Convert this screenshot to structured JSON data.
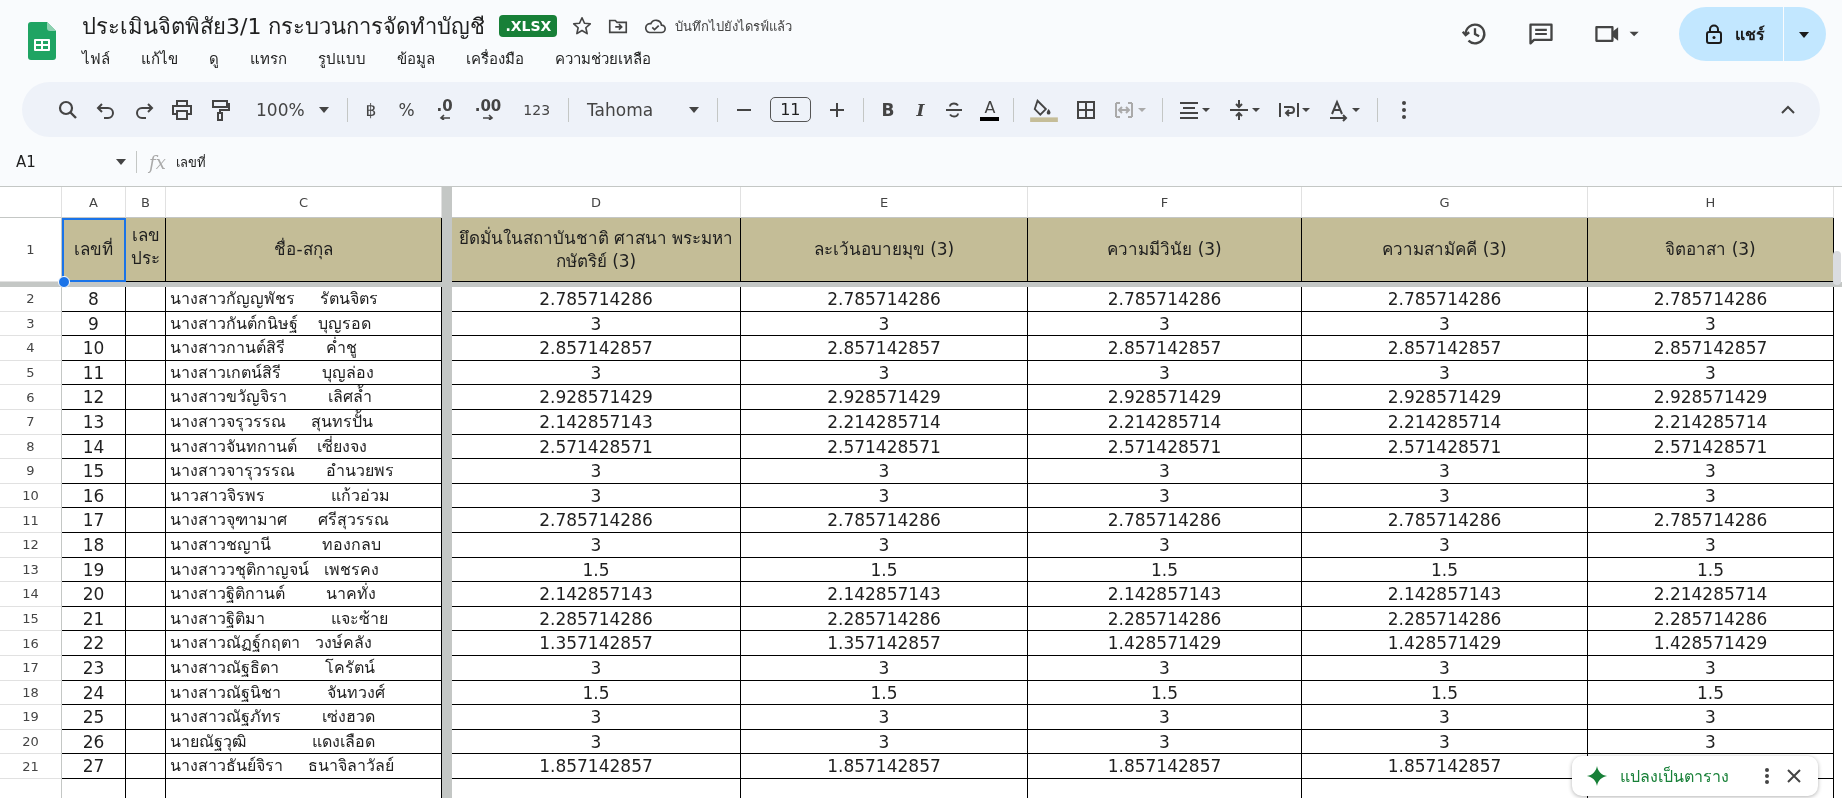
{
  "document": {
    "title": "ประเมินจิตพิสัย3/1 กระบวนการจัดทำบัญชี",
    "format_badge": ".XLSX",
    "save_status": "บันทึกไปยังไดรฟ์แล้ว"
  },
  "menu": [
    "ไฟล์",
    "แก้ไข",
    "ดู",
    "แทรก",
    "รูปแบบ",
    "ข้อมูล",
    "เครื่องมือ",
    "ความช่วยเหลือ"
  ],
  "share_button": "แชร์",
  "toolbar": {
    "zoom": "100%",
    "currency": "฿",
    "percent": "%",
    "decrease_decimals": ".0",
    "increase_decimals": ".00",
    "number_format": "123",
    "font": "Tahoma",
    "font_size": "11",
    "bold": "B",
    "italic": "I",
    "text_color": "A"
  },
  "formula_bar": {
    "name_box": "A1",
    "fx": "fx",
    "value": "เลขที่"
  },
  "sheet": {
    "columns": [
      "A",
      "B",
      "C",
      "D",
      "E",
      "F",
      "G",
      "H"
    ],
    "header_row": {
      "number": "1",
      "cells": [
        {
          "text": "เลขที่",
          "selected": true
        },
        {
          "text": "เลขประ",
          "selected": false
        },
        {
          "text": "ชื่อ-สกุล",
          "selected": false
        },
        {
          "text": "ยึดมั่นในสถาบันชาติ ศาสนา พระมหากษัตริย์ (3)",
          "selected": false
        },
        {
          "text": "ละเว้นอบายมุข (3)",
          "selected": false
        },
        {
          "text": "ความมีวินัย (3)",
          "selected": false
        },
        {
          "text": "ความสามัคคี (3)",
          "selected": false
        },
        {
          "text": "จิตอาสา (3)",
          "selected": false
        }
      ]
    },
    "rows": [
      {
        "number": "2",
        "no": "8",
        "name": "นางสาวกัญญพัชร     รัตนจิตร",
        "scores": [
          "2.785714286",
          "2.785714286",
          "2.785714286",
          "2.785714286",
          "2.785714286"
        ]
      },
      {
        "number": "3",
        "no": "9",
        "name": "นางสาวกันต์กนิษฐ์    บุญรอด",
        "scores": [
          "3",
          "3",
          "3",
          "3",
          "3"
        ]
      },
      {
        "number": "4",
        "no": "10",
        "name": "นางสาวกานต์สิรี        ค่ำชู",
        "scores": [
          "2.857142857",
          "2.857142857",
          "2.857142857",
          "2.857142857",
          "2.857142857"
        ]
      },
      {
        "number": "5",
        "no": "11",
        "name": "นางสาวเกตน์สิรี        บุญล่อง",
        "scores": [
          "3",
          "3",
          "3",
          "3",
          "3"
        ]
      },
      {
        "number": "6",
        "no": "12",
        "name": "นางสาวขวัญจิรา        เลิศล้ำ",
        "scores": [
          "2.928571429",
          "2.928571429",
          "2.928571429",
          "2.928571429",
          "2.928571429"
        ]
      },
      {
        "number": "7",
        "no": "13",
        "name": "นางสาวจรุวรรณ     สุนทรปั้น",
        "scores": [
          "2.142857143",
          "2.214285714",
          "2.214285714",
          "2.214285714",
          "2.214285714"
        ]
      },
      {
        "number": "8",
        "no": "14",
        "name": "นางสาวจันทกานต์    เซี่ยงจง",
        "scores": [
          "2.571428571",
          "2.571428571",
          "2.571428571",
          "2.571428571",
          "2.571428571"
        ]
      },
      {
        "number": "9",
        "no": "15",
        "name": "นางสาวจารุวรรณ      อำนวยพร",
        "scores": [
          "3",
          "3",
          "3",
          "3",
          "3"
        ]
      },
      {
        "number": "10",
        "no": "16",
        "name": "นาวสาวจิรพร             แก้วอ่วม",
        "scores": [
          "3",
          "3",
          "3",
          "3",
          "3"
        ]
      },
      {
        "number": "11",
        "no": "17",
        "name": "นางสาวจุฑามาศ      ศรีสุวรรณ",
        "scores": [
          "2.785714286",
          "2.785714286",
          "2.785714286",
          "2.785714286",
          "2.785714286"
        ]
      },
      {
        "number": "12",
        "no": "18",
        "name": "นางสาวชญานี          ทองกลบ",
        "scores": [
          "3",
          "3",
          "3",
          "3",
          "3"
        ]
      },
      {
        "number": "13",
        "no": "19",
        "name": "นางสาววชุติกาญจน์   เพชรคง",
        "scores": [
          "1.5",
          "1.5",
          "1.5",
          "1.5",
          "1.5"
        ]
      },
      {
        "number": "14",
        "no": "20",
        "name": "นางสาวฐิติกานต์        นาคทั่ง",
        "scores": [
          "2.142857143",
          "2.142857143",
          "2.142857143",
          "2.142857143",
          "2.214285714"
        ]
      },
      {
        "number": "15",
        "no": "21",
        "name": "นางสาวฐิติมา             แจะซ้าย",
        "scores": [
          "2.285714286",
          "2.285714286",
          "2.285714286",
          "2.285714286",
          "2.285714286"
        ]
      },
      {
        "number": "16",
        "no": "22",
        "name": "นางสาวณัฏฐ์กฤตา   วงษ์คลัง",
        "scores": [
          "1.357142857",
          "1.357142857",
          "1.428571429",
          "1.428571429",
          "1.428571429"
        ]
      },
      {
        "number": "17",
        "no": "23",
        "name": "นางสาวณัฐธิดา         โครัตน์",
        "scores": [
          "3",
          "3",
          "3",
          "3",
          "3"
        ]
      },
      {
        "number": "18",
        "no": "24",
        "name": "นางสาวณัฐนิชา         จันทวงศ์",
        "scores": [
          "1.5",
          "1.5",
          "1.5",
          "1.5",
          "1.5"
        ]
      },
      {
        "number": "19",
        "no": "25",
        "name": "นางสาวณัฐภัทร        เซ่งฮวด",
        "scores": [
          "3",
          "3",
          "3",
          "3",
          "3"
        ]
      },
      {
        "number": "20",
        "no": "26",
        "name": "นายณัฐวุฒิ             แดงเลือด",
        "scores": [
          "3",
          "3",
          "3",
          "3",
          "3"
        ]
      },
      {
        "number": "21",
        "no": "27",
        "name": "นางสาวธันย์จิรา     ธนาจิลาวัลย์",
        "scores": [
          "1.857142857",
          "1.857142857",
          "1.857142857",
          "1.857142857"
        ]
      }
    ]
  },
  "toast": {
    "label": "แปลงเป็นตาราง"
  }
}
